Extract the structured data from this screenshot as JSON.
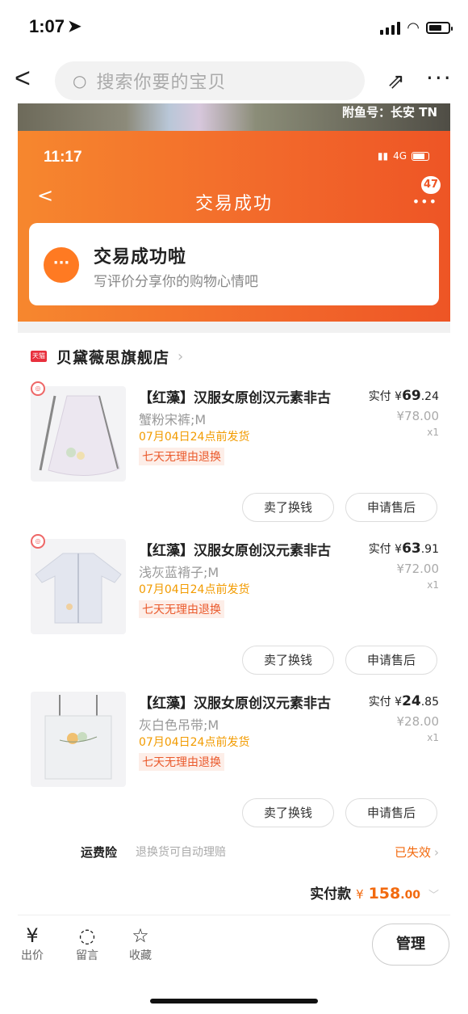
{
  "status_bar": {
    "time": "1:07"
  },
  "header": {
    "search_placeholder": "搜索你要的宝贝"
  },
  "photo_caption": "附鱼号：长安 TN",
  "embedded": {
    "time": "11:17",
    "network": "4G",
    "title": "交易成功",
    "badge": "47",
    "card_title": "交易成功啦",
    "card_sub": "写评价分享你的购物心情吧"
  },
  "shop": {
    "name": "贝黛薇思旗舰店"
  },
  "items": [
    {
      "title": "【红藻】汉服女原创汉元素非古",
      "sku": "蟹粉宋裤;M",
      "ship": "07月04日24点前发货",
      "tag": "七天无理由退换",
      "paid_label": "实付",
      "currency": "¥",
      "paid_int": "69",
      "paid_dec": ".24",
      "orig": "¥78.00",
      "qty": "x1",
      "sell_btn": "卖了换钱",
      "after_btn": "申请售后"
    },
    {
      "title": "【红藻】汉服女原创汉元素非古",
      "sku": "浅灰蓝褙子;M",
      "ship": "07月04日24点前发货",
      "tag": "七天无理由退换",
      "paid_label": "实付",
      "currency": "¥",
      "paid_int": "63",
      "paid_dec": ".91",
      "orig": "¥72.00",
      "qty": "x1",
      "sell_btn": "卖了换钱",
      "after_btn": "申请售后"
    },
    {
      "title": "【红藻】汉服女原创汉元素非古",
      "sku": "灰白色吊带;M",
      "ship": "07月04日24点前发货",
      "tag": "七天无理由退换",
      "paid_label": "实付",
      "currency": "¥",
      "paid_int": "24",
      "paid_dec": ".85",
      "orig": "¥28.00",
      "qty": "x1",
      "sell_btn": "卖了换钱",
      "after_btn": "申请售后"
    }
  ],
  "insurance": {
    "label": "运费险",
    "desc": "退换货可自动理赔",
    "status": "已失效"
  },
  "total": {
    "label": "实付款",
    "currency": "¥",
    "int": "158",
    "dec": ".00"
  },
  "bottom": {
    "offer": "出价",
    "message": "留言",
    "favorite": "收藏",
    "manage": "管理"
  },
  "colors": {
    "accent": "#f26a0f",
    "orange_header": "#f2682b",
    "ship": "#f29b00"
  }
}
